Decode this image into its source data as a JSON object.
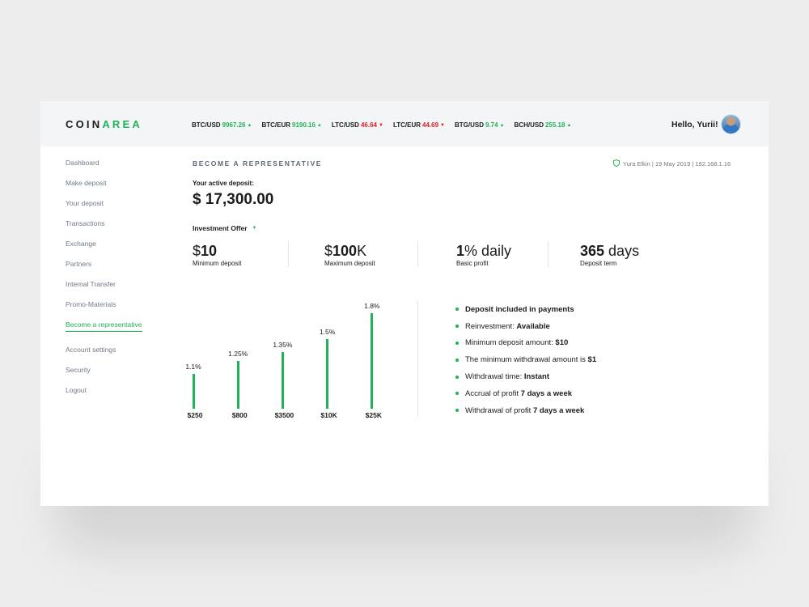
{
  "brand": {
    "part1": "COIN",
    "part2": "AREA"
  },
  "ticker": [
    {
      "pair": "BTC/USD",
      "value": "9967.26",
      "dir": "up"
    },
    {
      "pair": "BTC/EUR",
      "value": "9190.16",
      "dir": "up"
    },
    {
      "pair": "LTC/USD",
      "value": "46.64",
      "dir": "down"
    },
    {
      "pair": "LTC/EUR",
      "value": "44.69",
      "dir": "down"
    },
    {
      "pair": "BTG/USD",
      "value": "9.74",
      "dir": "up"
    },
    {
      "pair": "BCH/USD",
      "value": "255.18",
      "dir": "up"
    }
  ],
  "greeting": "Hello, Yurii!",
  "sidebar": {
    "items": [
      {
        "label": "Dashboard"
      },
      {
        "label": "Make deposit"
      },
      {
        "label": "Your deposit"
      },
      {
        "label": "Transactions"
      },
      {
        "label": "Exchange"
      },
      {
        "label": "Partners"
      },
      {
        "label": "Internal Transfer"
      },
      {
        "label": "Promo-Materials"
      },
      {
        "label": "Become a representative",
        "active": true
      }
    ],
    "secondary": [
      {
        "label": "Account settings"
      },
      {
        "label": "Security"
      },
      {
        "label": "Logout"
      }
    ]
  },
  "main": {
    "title": "BECOME A REPRESENTATIVE",
    "session": "Yura Elkin | 19 May 2019 | 192.168.1.16",
    "deposit_label": "Your active deposit:",
    "deposit_value": "$ 17,300.00",
    "offer_label": "Investment Offer",
    "stats": [
      {
        "prefix": "$",
        "value": "10",
        "suffix": "",
        "label": "Minimum deposit"
      },
      {
        "prefix": "$",
        "value": "100",
        "suffix": "K",
        "label": "Maximum deposit"
      },
      {
        "prefix": "",
        "value": "1",
        "suffix": "% daily",
        "label": "Basic profit"
      },
      {
        "prefix": "",
        "value": "365",
        "suffix": " days",
        "label": "Deposit term"
      }
    ],
    "features": [
      {
        "text": "",
        "bold": "Deposit included in payments"
      },
      {
        "text": "Reinvestment: ",
        "bold": "Available"
      },
      {
        "text": "Minimum deposit amount: ",
        "bold": "$10"
      },
      {
        "text": "The minimum withdrawal amount is ",
        "bold": "$1"
      },
      {
        "text": "Withdrawal time: ",
        "bold": "Instant"
      },
      {
        "text": "Accrual of profit ",
        "bold": "7 days a week"
      },
      {
        "text": "Withdrawal of profit ",
        "bold": "7 days a week"
      }
    ]
  },
  "colors": {
    "accent": "#1fb357",
    "down": "#d9202c",
    "muted": "#6f7985"
  },
  "chart_data": {
    "type": "bar",
    "categories": [
      "$250",
      "$800",
      "$3500",
      "$10K",
      "$25K"
    ],
    "values": [
      1.1,
      1.25,
      1.35,
      1.5,
      1.8
    ],
    "data_labels": [
      "1.1%",
      "1.25%",
      "1.35%",
      "1.5%",
      "1.8%"
    ],
    "ylim": [
      0.7,
      1.8
    ],
    "grid": false
  }
}
